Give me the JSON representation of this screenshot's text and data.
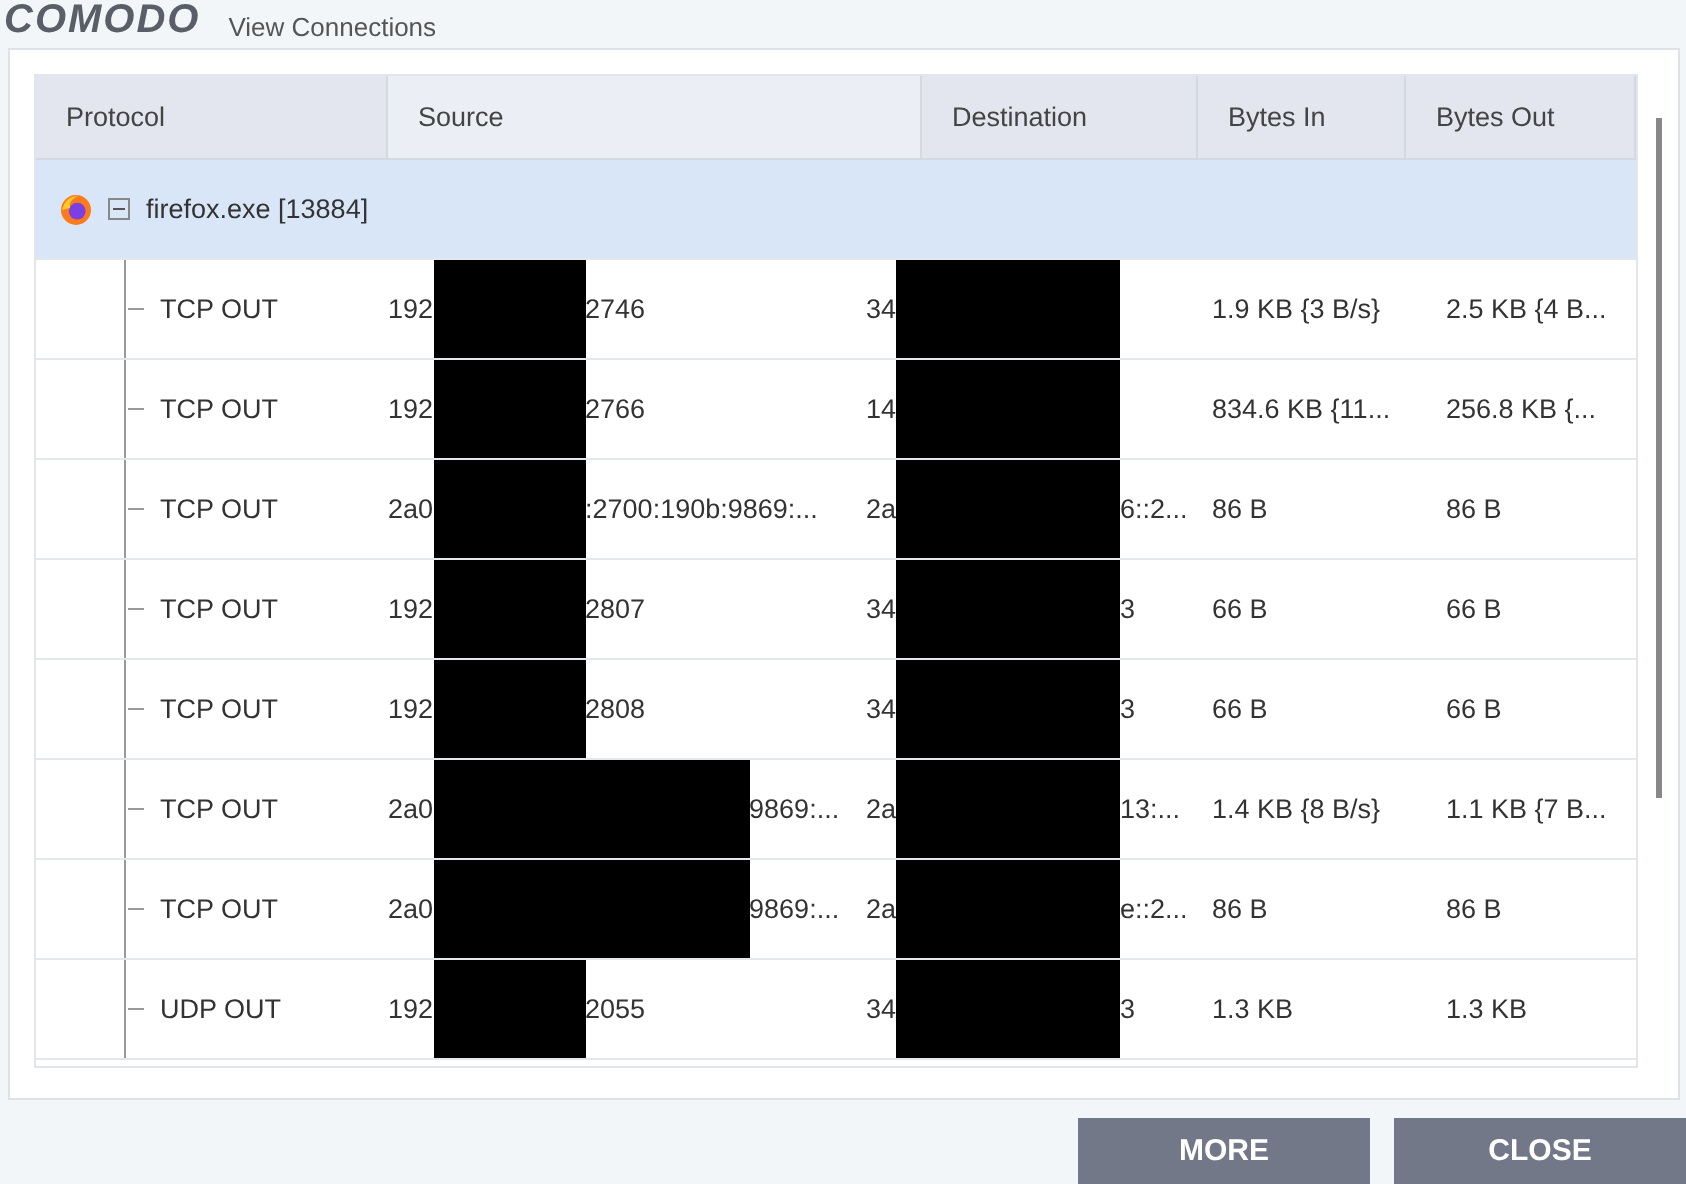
{
  "window": {
    "logo": "COMODO",
    "title": "View Connections"
  },
  "table": {
    "columns": [
      "Protocol",
      "Source",
      "Destination",
      "Bytes In",
      "Bytes Out"
    ],
    "group": {
      "label": "firefox.exe [13884]",
      "expanded": true,
      "selected": true
    },
    "rows": [
      {
        "protocol": "TCP OUT",
        "source": {
          "before": "192",
          "after": "2746",
          "wide": false
        },
        "destination": {
          "before": "34"
        },
        "bytes_in": "1.9 KB {3 B/s}",
        "bytes_out": "2.5 KB {4 B..."
      },
      {
        "protocol": "TCP OUT",
        "source": {
          "before": "192",
          "after": "2766",
          "wide": false
        },
        "destination": {
          "before": "14"
        },
        "bytes_in": "834.6 KB {11...",
        "bytes_out": "256.8 KB {..."
      },
      {
        "protocol": "TCP OUT",
        "source": {
          "before": "2a0",
          "after": ":2700:190b:9869:...",
          "wide": false
        },
        "destination": {
          "before": "2a",
          "after": "6::2..."
        },
        "bytes_in": "86 B",
        "bytes_out": "86 B"
      },
      {
        "protocol": "TCP OUT",
        "source": {
          "before": "192",
          "after": "2807",
          "wide": false
        },
        "destination": {
          "before": "34",
          "after": "3"
        },
        "bytes_in": "66 B",
        "bytes_out": "66 B"
      },
      {
        "protocol": "TCP OUT",
        "source": {
          "before": "192",
          "after": "2808",
          "wide": false
        },
        "destination": {
          "before": "34",
          "after": "3"
        },
        "bytes_in": "66 B",
        "bytes_out": "66 B"
      },
      {
        "protocol": "TCP OUT",
        "source": {
          "before": "2a0",
          "after": "9869:...",
          "wide": true
        },
        "destination": {
          "before": "2a",
          "after": "13:..."
        },
        "bytes_in": "1.4 KB {8 B/s}",
        "bytes_out": "1.1 KB {7 B..."
      },
      {
        "protocol": "TCP OUT",
        "source": {
          "before": "2a0",
          "after": "9869:...",
          "wide": true
        },
        "destination": {
          "before": "2a",
          "after": "e::2..."
        },
        "bytes_in": "86 B",
        "bytes_out": "86 B"
      },
      {
        "protocol": "UDP OUT",
        "source": {
          "before": "192",
          "after": "2055",
          "wide": false
        },
        "destination": {
          "before": "34",
          "after": "3"
        },
        "bytes_in": "1.3 KB",
        "bytes_out": "1.3 KB"
      }
    ]
  },
  "buttons": [
    {
      "label": "MORE"
    },
    {
      "label": "CLOSE"
    }
  ]
}
